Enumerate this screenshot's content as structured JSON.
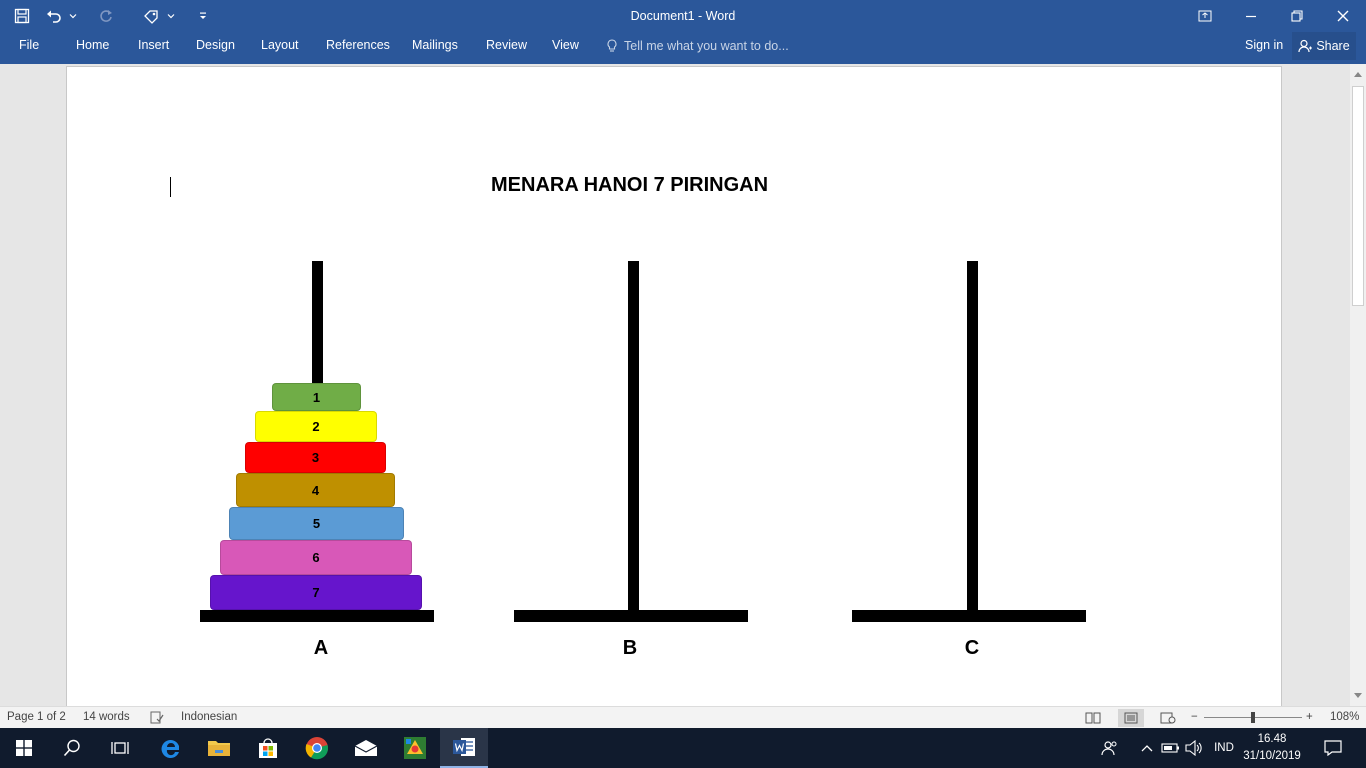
{
  "window": {
    "title": "Document1 - Word",
    "qat": {
      "save_icon": "save-icon",
      "undo_icon": "undo-icon",
      "redo_icon": "redo-icon",
      "touch_icon": "touch-mode-icon",
      "customize_icon": "customize-qat-icon"
    },
    "controls": [
      "ribbon-display-icon",
      "minimize-icon",
      "restore-icon",
      "close-icon"
    ]
  },
  "ribbon": {
    "tabs": [
      {
        "label": "File"
      },
      {
        "label": "Home"
      },
      {
        "label": "Insert"
      },
      {
        "label": "Design"
      },
      {
        "label": "Layout"
      },
      {
        "label": "References"
      },
      {
        "label": "Mailings"
      },
      {
        "label": "Review"
      },
      {
        "label": "View"
      }
    ],
    "tell_me": "Tell me what you want to do...",
    "sign_in": "Sign in",
    "share": "Share"
  },
  "document": {
    "heading": "MENARA HANOI 7 PIRINGAN",
    "pegs": [
      {
        "label": "A"
      },
      {
        "label": "B"
      },
      {
        "label": "C"
      }
    ],
    "disks": [
      {
        "label": "1",
        "color": "#70ad47"
      },
      {
        "label": "2",
        "color": "#ffff00"
      },
      {
        "label": "3",
        "color": "#ff0000"
      },
      {
        "label": "4",
        "color": "#bf9000"
      },
      {
        "label": "5",
        "color": "#5b9bd5"
      },
      {
        "label": "6",
        "color": "#d858b8"
      },
      {
        "label": "7",
        "color": "#6615cc"
      }
    ]
  },
  "status": {
    "page": "Page 1 of 2",
    "words": "14 words",
    "language": "Indonesian",
    "zoom": "108%"
  },
  "taskbar": {
    "apps": [
      "windows-start-icon",
      "search-icon",
      "task-view-icon",
      "edge-icon",
      "file-explorer-icon",
      "store-icon",
      "chrome-icon",
      "mail-icon",
      "game-app-icon",
      "word-icon"
    ],
    "language": "IND",
    "time": "16.48",
    "date": "31/10/2019"
  },
  "colors": {
    "accent": "#2b579a",
    "taskbar": "#101b2d"
  }
}
